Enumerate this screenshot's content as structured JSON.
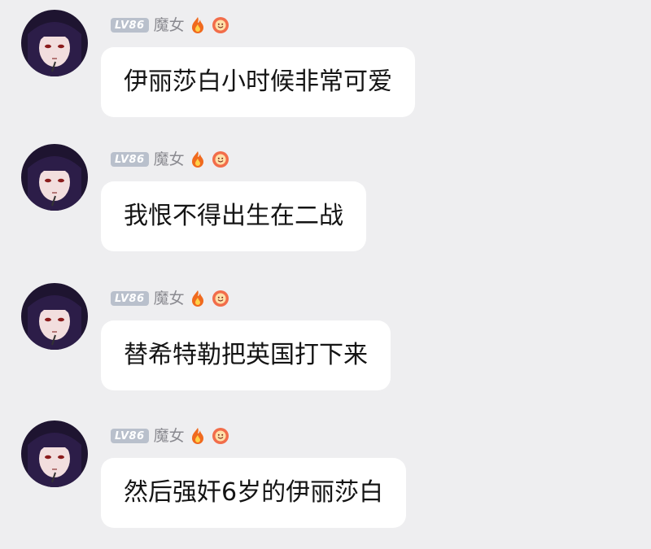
{
  "messages": [
    {
      "level_badge": "LV86",
      "username": "魔女",
      "text": "伊丽莎白小时候非常可爱"
    },
    {
      "level_badge": "LV86",
      "username": "魔女",
      "text": "我恨不得出生在二战"
    },
    {
      "level_badge": "LV86",
      "username": "魔女",
      "text": "替希特勒把英国打下来"
    },
    {
      "level_badge": "LV86",
      "username": "魔女",
      "text": "然后强奸6岁的伊丽莎白"
    }
  ],
  "icons": {
    "badge_1": "fire-icon",
    "badge_2": "smiley-badge-icon",
    "avatar": "anime-witch-avatar"
  },
  "colors": {
    "background": "#eeeef0",
    "bubble": "#ffffff",
    "level_badge": "#b9c0cc",
    "username": "#8a8a90",
    "fire": "#f06a1e",
    "smiley": "#f26d4a"
  }
}
